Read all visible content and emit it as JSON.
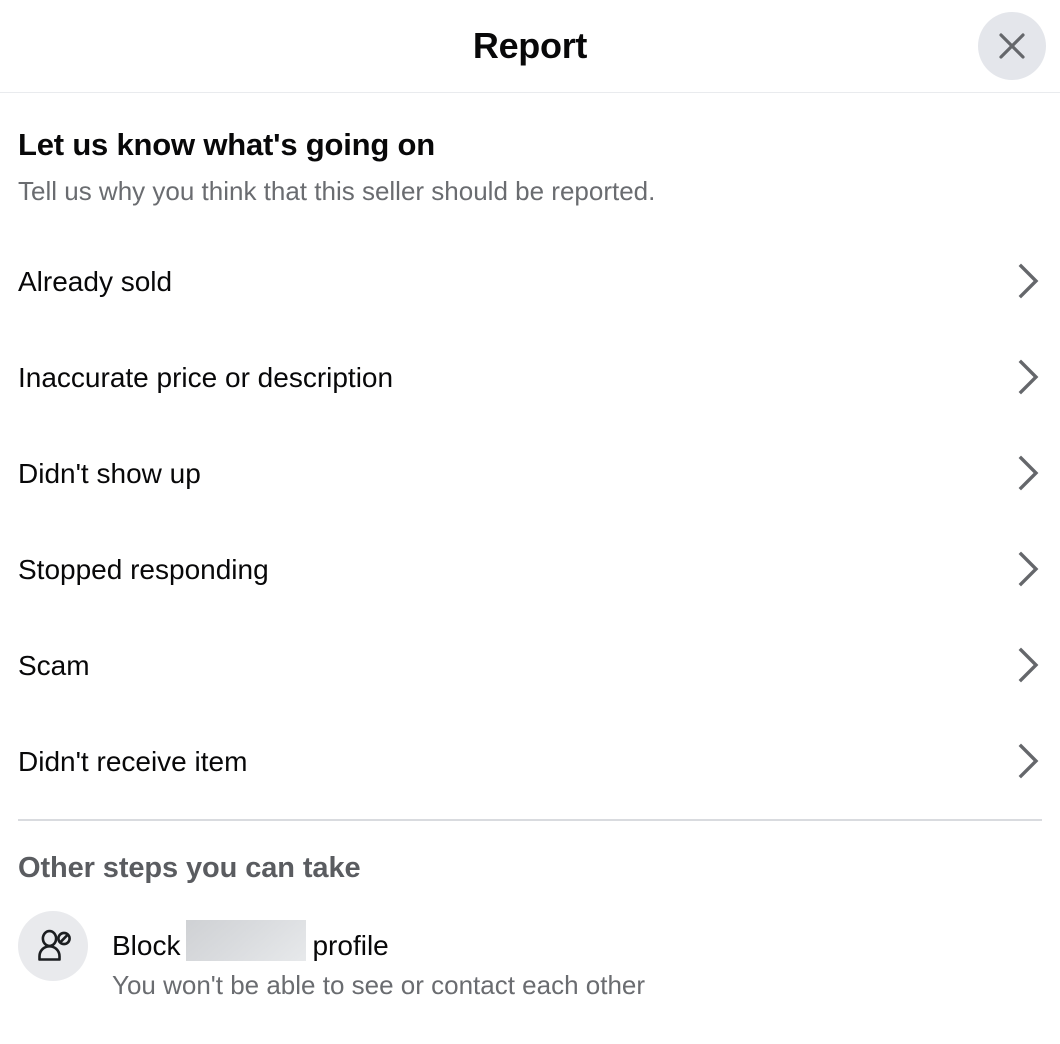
{
  "header": {
    "title": "Report",
    "close_icon": "close-icon",
    "close_label": "Close"
  },
  "intro": {
    "title": "Let us know what's going on",
    "subtitle": "Tell us why you think that this seller should be reported."
  },
  "reasons": [
    {
      "label": "Already sold",
      "chevron_icon": "chevron-right-icon"
    },
    {
      "label": "Inaccurate price or description",
      "chevron_icon": "chevron-right-icon"
    },
    {
      "label": "Didn't show up",
      "chevron_icon": "chevron-right-icon"
    },
    {
      "label": "Stopped responding",
      "chevron_icon": "chevron-right-icon"
    },
    {
      "label": "Scam",
      "chevron_icon": "chevron-right-icon"
    },
    {
      "label": "Didn't receive item",
      "chevron_icon": "chevron-right-icon"
    }
  ],
  "other_steps": {
    "title": "Other steps you can take",
    "actions": [
      {
        "icon": "block-person-icon",
        "title_prefix": "Block",
        "title_redacted": "",
        "title_suffix": "profile",
        "subtitle": "You won't be able to see or contact each other"
      }
    ]
  },
  "colors": {
    "background": "#ffffff",
    "primary_text": "#080809",
    "secondary_text": "#6a6c70",
    "heading_gray": "#5a5c60",
    "icon_gray": "#65676b",
    "divider": "#d9dbdf",
    "header_divider": "#e9ebee",
    "close_button_bg": "#e4e6eb",
    "action_icon_bg": "#e9eaed"
  }
}
